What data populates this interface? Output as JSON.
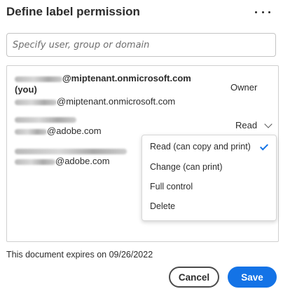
{
  "dialog": {
    "title": "Define label permission",
    "more_icon": "more-horizontal-icon"
  },
  "search": {
    "placeholder": "Specify user, group or domain",
    "value": ""
  },
  "users": [
    {
      "name_visible": "@miptenant.onmicrosoft.com",
      "you_tag": "(you)",
      "email_visible": "@miptenant.onmicrosoft.com",
      "role": "Owner"
    },
    {
      "email_visible": "@adobe.com",
      "role": "Read"
    },
    {
      "email_visible": "@adobe.com"
    }
  ],
  "role_dropdown": {
    "selected": "Read (can copy and print)",
    "options": [
      "Read (can copy and print)",
      "Change (can print)",
      "Full control",
      "Delete"
    ]
  },
  "footer": {
    "expires_text": "This document expires on 09/26/2022",
    "cancel_label": "Cancel",
    "save_label": "Save"
  },
  "colors": {
    "accent": "#1473e6",
    "text": "#2c2c2c",
    "border": "#d0d0d0"
  }
}
